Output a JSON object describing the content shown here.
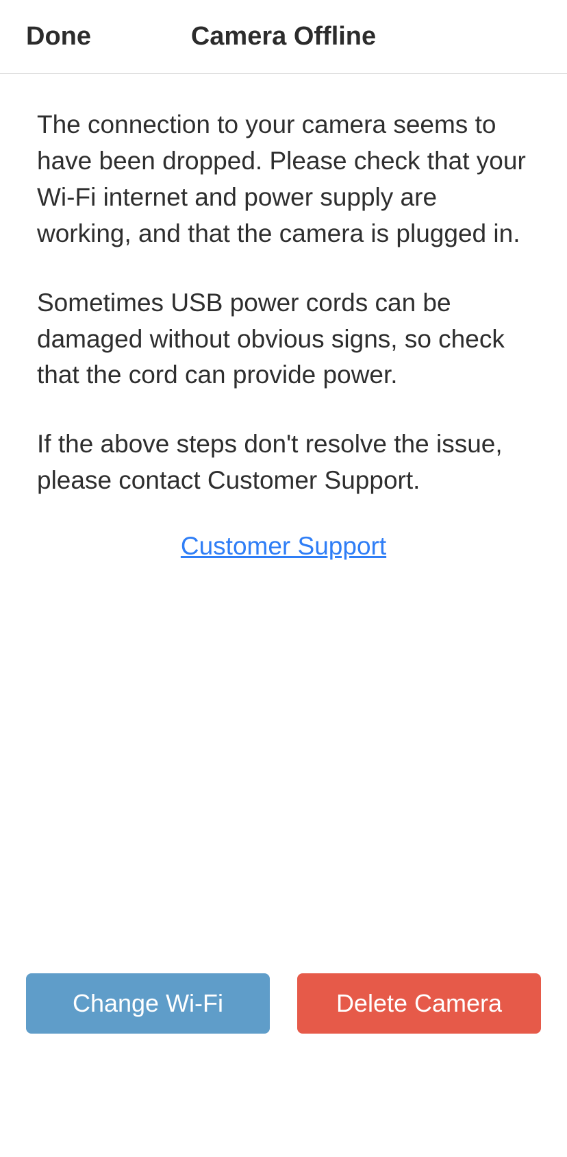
{
  "header": {
    "done_label": "Done",
    "title": "Camera Offline"
  },
  "content": {
    "paragraph1": "The connection to your camera seems to have been dropped. Please check that your Wi-Fi internet and power supply are working, and that the camera is plugged in.",
    "paragraph2": "Sometimes USB power cords can be damaged without obvious signs, so check that the cord can provide power.",
    "paragraph3": "If the above steps don't resolve the issue, please contact Customer Support.",
    "support_link_label": "Customer Support"
  },
  "footer": {
    "change_wifi_label": "Change Wi-Fi",
    "delete_camera_label": "Delete Camera"
  },
  "colors": {
    "link": "#2f7ef6",
    "button_blue": "#5f9dc9",
    "button_red": "#e65a49"
  }
}
